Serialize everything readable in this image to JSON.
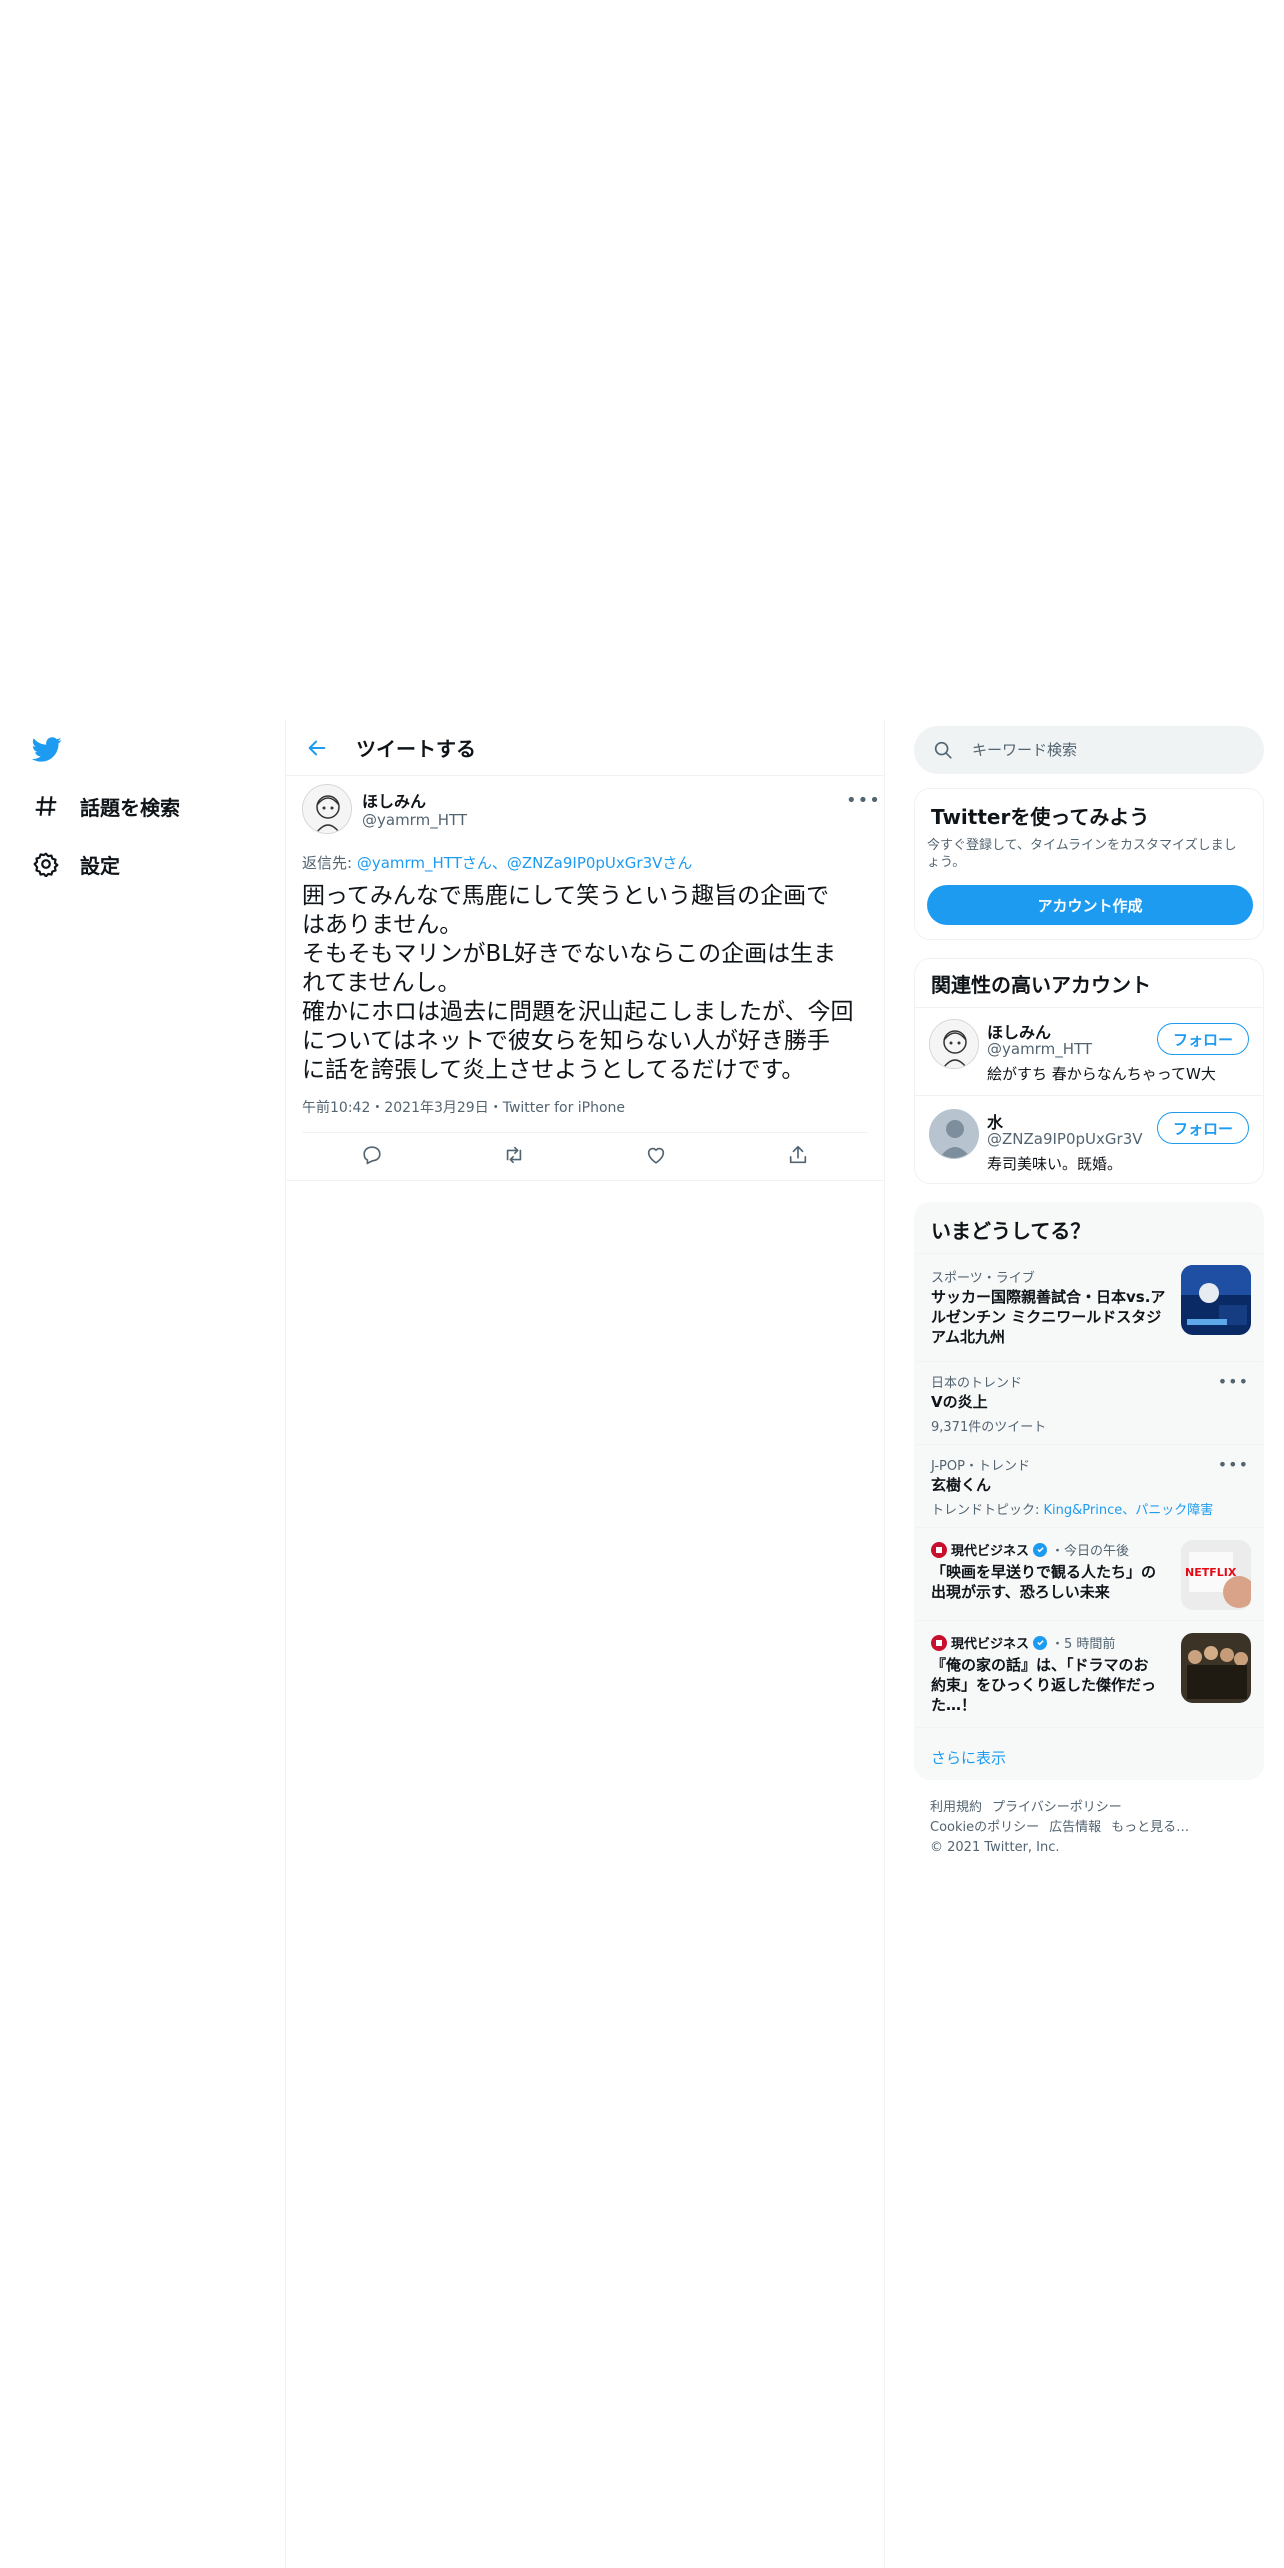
{
  "nav": {
    "items": [
      {
        "label": "話題を検索",
        "icon": "hashtag-icon"
      },
      {
        "label": "設定",
        "icon": "gear-icon"
      }
    ]
  },
  "header": {
    "title": "ツイートする"
  },
  "tweet": {
    "author_name": "ほしみん",
    "author_handle": "@yamrm_HTT",
    "reply_prefix": "返信先: ",
    "reply_user1": "@yamrm_HTT",
    "reply_suffix1": "さん、",
    "reply_user2": "@ZNZa9IP0pUxGr3V",
    "reply_suffix2": "さん",
    "text_lines": [
      "囲ってみんなで馬鹿にして笑うという趣旨の企画で",
      "はありません。",
      "そもそもマリンがBL好きでないならこの企画は生ま",
      "れてませんし。",
      "確かにホロは過去に問題を沢山起こしましたが、今回",
      "についてはネットで彼女らを知らない人が好き勝手",
      "に話を誇張して炎上させようとしてるだけです。"
    ],
    "time": "午前10:42",
    "date": "2021年3月29日",
    "source": "Twitter for iPhone",
    "sep": "・"
  },
  "search": {
    "placeholder": "キーワード検索"
  },
  "signup": {
    "title": "Twitterを使ってみよう",
    "desc_line1": "今すぐ登録して、タイムラインをカスタマイズしまし",
    "desc_line2": "ょう。",
    "button": "アカウント作成"
  },
  "related": {
    "title": "関連性の高いアカウント",
    "follow_label": "フォロー",
    "accounts": [
      {
        "name": "ほしみん",
        "handle": "@yamrm_HTT",
        "bio": "絵がすち 春からなんちゃってW大"
      },
      {
        "name": "水",
        "handle": "@ZNZa9IP0pUxGr3V",
        "bio": "寿司美味い。既婚。"
      }
    ]
  },
  "trends": {
    "title": "いまどうしてる？",
    "items": [
      {
        "category": "スポーツ・ライブ",
        "title_lines": [
          "サッカー国際親善試合・日本vs.ア",
          "ルゼンチン ミクニワールドスタジ",
          "アム北九州"
        ]
      },
      {
        "category": "日本のトレンド",
        "title": "Vの炎上",
        "sub": "9,371件のツイート"
      },
      {
        "category": "J-POP・トレンド",
        "title": "玄樹くん",
        "sub_prefix": "トレンドトピック: ",
        "sub_links": "King&Prince、パニック障害"
      }
    ],
    "news": [
      {
        "source": "現代ビジネス",
        "time": "・今日の午後",
        "title_lines": [
          "「映画を早送りで観る人たち」の",
          "出現が示す、恐ろしい未来"
        ],
        "thumb_text": "NETFLIX"
      },
      {
        "source": "現代ビジネス",
        "time": "・5 時間前",
        "title_lines": [
          "『俺の家の話』は、「ドラマのお",
          "約束」をひっくり返した傑作だっ",
          "た…！"
        ]
      }
    ],
    "show_more": "さらに表示"
  },
  "footer": {
    "links_row1": [
      "利用規約",
      "プライバシーポリシー"
    ],
    "links_row2": [
      "Cookieのポリシー",
      "広告情報",
      "もっと見る…"
    ],
    "copyright": "© 2021 Twitter, Inc."
  },
  "colors": {
    "accent": "#1d9bf0",
    "text": "#0f1419",
    "secondary": "#536471"
  }
}
